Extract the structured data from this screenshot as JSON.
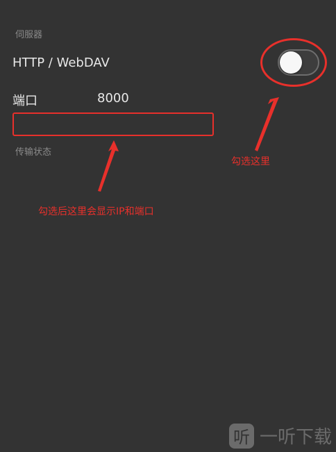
{
  "server": {
    "section_label": "伺服器",
    "http_label": "HTTP / WebDAV",
    "toggle_on": false
  },
  "port": {
    "label": "端口",
    "value": "8000"
  },
  "ip_display": {
    "value": ""
  },
  "status": {
    "section_label": "传输状态"
  },
  "annotations": {
    "toggle_hint": "勾选这里",
    "ip_hint": "勾选后这里会显示IP和端口",
    "color": "#e8302b"
  },
  "watermark": {
    "icon_glyph": "听",
    "text": "一听下载"
  }
}
